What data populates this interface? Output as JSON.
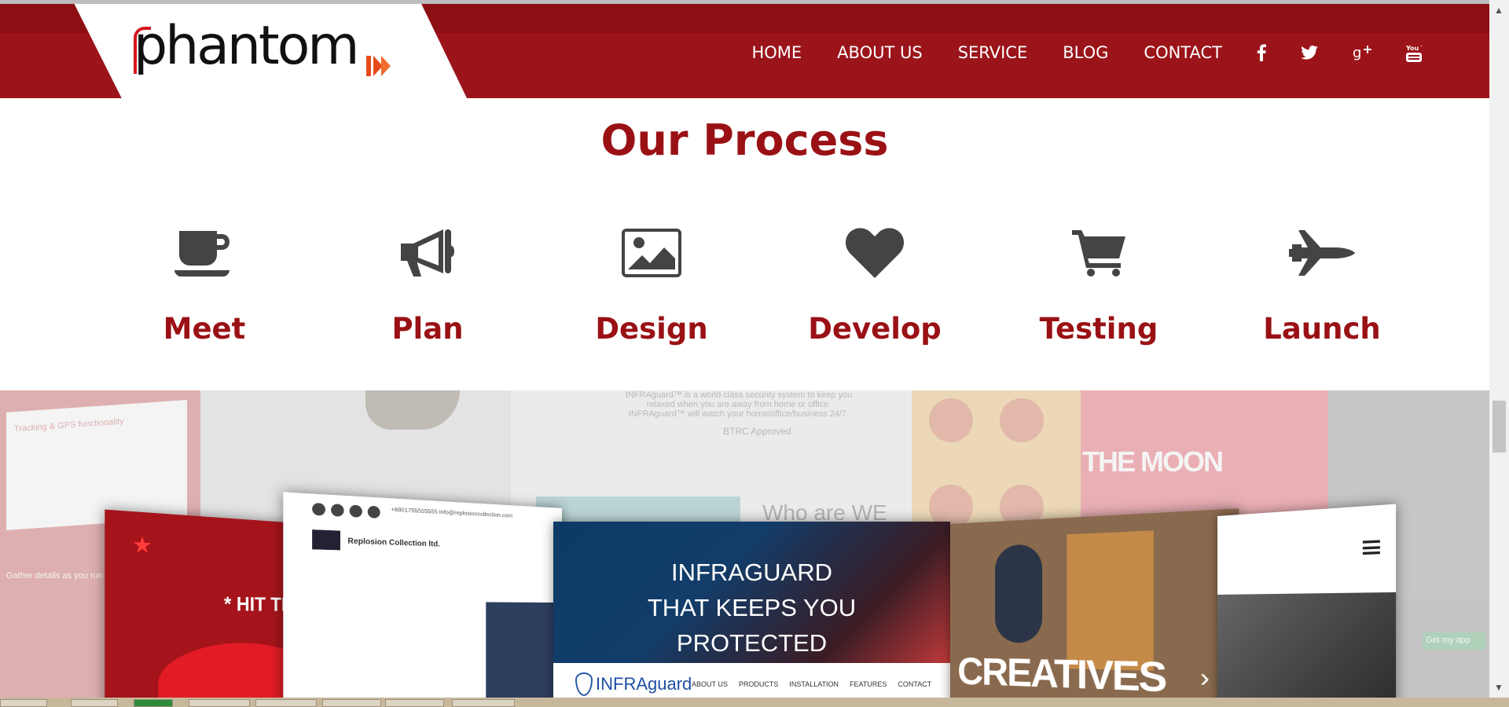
{
  "nav": {
    "items": [
      "HOME",
      "ABOUT US",
      "SERVICE",
      "BLOG",
      "CONTACT"
    ],
    "social": [
      "facebook-icon",
      "twitter-icon",
      "google-plus-icon",
      "youtube-icon"
    ],
    "youtube_text": "You Tube"
  },
  "logo": {
    "text": "phantom",
    "icon": "phantom-logo"
  },
  "process": {
    "title": "Our Process",
    "steps": [
      {
        "label": "Meet",
        "icon": "coffee-cup-icon"
      },
      {
        "label": "Plan",
        "icon": "megaphone-icon"
      },
      {
        "label": "Design",
        "icon": "image-icon"
      },
      {
        "label": "Develop",
        "icon": "heart-icon"
      },
      {
        "label": "Testing",
        "icon": "shopping-cart-icon"
      },
      {
        "label": "Launch",
        "icon": "space-shuttle-icon"
      }
    ]
  },
  "showcase": {
    "bg_texts": {
      "tracking": "Tracking & GPS functionality",
      "gather": "Gather details as you run",
      "infraguard_blurb": "INFRAguard™ is a world class security system to keep you relaxed when you are away from home or office. INFRAguard™ will watch your home/office/business 24/7.",
      "btrc": "BTRC Approved",
      "who": "Who are WE",
      "moon": "THE MOON",
      "get_app": "Get my app"
    },
    "cards": {
      "hit_the": "* HIT THE GR",
      "collection": "Replosion Collection ltd.",
      "collection_contact": "+8801755555555  info@replosioncollection.com",
      "infraguard_heading": "INFRAGUARD THAT KEEPS YOU PROTECTED",
      "infraguard_line1": "INFRAGUARD",
      "infraguard_line2": "THAT KEEPS YOU",
      "infraguard_line3": "PROTECTED",
      "infraguard_brand": "INFRAguard",
      "infraguard_menu": [
        "ABOUT US",
        "PRODUCTS",
        "INSTALLATION",
        "FEATURES",
        "CONTACT"
      ],
      "creatives": "CREATIVES"
    }
  },
  "colors": {
    "brand_red": "#9a1115",
    "header_red": "#8d0e13",
    "icon_gray": "#444444",
    "logo_accent": "#e84a1a"
  }
}
